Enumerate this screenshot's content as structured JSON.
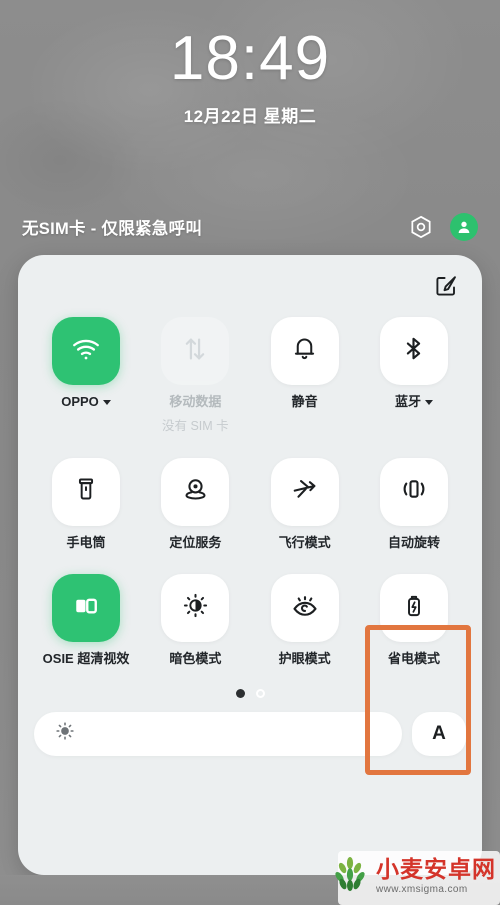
{
  "lockscreen": {
    "time": "18:49",
    "date": "12月22日  星期二",
    "carrier_status": "无SIM卡 - 仅限紧急呼叫",
    "camera_icon": "camera-icon",
    "avatar_icon": "user-avatar-icon"
  },
  "panel": {
    "edit_icon": "edit-pencil-square-icon",
    "accent_on_color": "#2ec273",
    "panel_bg_color": "#eceff0",
    "highlight_color": "#e2763f",
    "rows": [
      [
        {
          "label": "OPPO",
          "sub": "",
          "icon": "wifi-icon",
          "state": "on",
          "has_caret": true
        },
        {
          "label": "移动数据",
          "sub": "没有 SIM 卡",
          "icon": "mobile-data-icon",
          "state": "disabled",
          "has_caret": false
        },
        {
          "label": "静音",
          "sub": "",
          "icon": "bell-icon",
          "state": "off",
          "has_caret": false
        },
        {
          "label": "蓝牙",
          "sub": "",
          "icon": "bluetooth-icon",
          "state": "off",
          "has_caret": true
        }
      ],
      [
        {
          "label": "手电筒",
          "sub": "",
          "icon": "flashlight-icon",
          "state": "off",
          "has_caret": false
        },
        {
          "label": "定位服务",
          "sub": "",
          "icon": "location-pin-icon",
          "state": "off",
          "has_caret": false
        },
        {
          "label": "飞行模式",
          "sub": "",
          "icon": "airplane-icon",
          "state": "off",
          "has_caret": false
        },
        {
          "label": "自动旋转",
          "sub": "",
          "icon": "auto-rotate-icon",
          "state": "off",
          "has_caret": false
        }
      ],
      [
        {
          "label": "OSIE 超清视效",
          "sub": "",
          "icon": "osie-split-screen-icon",
          "state": "on",
          "has_caret": false
        },
        {
          "label": "暗色模式",
          "sub": "",
          "icon": "dark-mode-icon",
          "state": "off",
          "has_caret": false
        },
        {
          "label": "护眼模式",
          "sub": "",
          "icon": "eye-comfort-icon",
          "state": "off",
          "has_caret": false
        },
        {
          "label": "省电模式",
          "sub": "",
          "icon": "battery-saver-icon",
          "state": "off",
          "has_caret": false
        }
      ]
    ],
    "page_dots": {
      "count": 2,
      "active_index": 0
    },
    "brightness": {
      "icon": "brightness-sun-icon",
      "value_percent": 0,
      "auto_label": "A"
    }
  },
  "watermark": {
    "title": "小麦安卓网",
    "url": "www.xmsigma.com",
    "logo_icon": "wheat-logo-icon"
  }
}
